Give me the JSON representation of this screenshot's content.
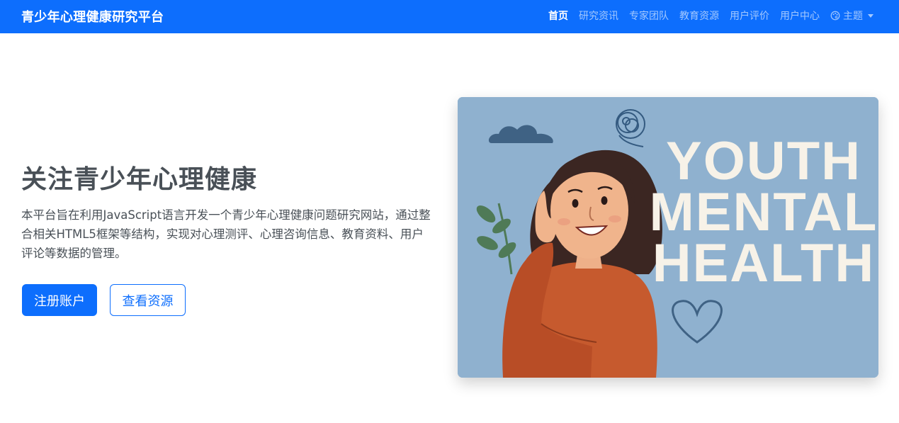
{
  "nav": {
    "brand": "青少年心理健康研究平台",
    "links": [
      {
        "label": "首页",
        "active": true
      },
      {
        "label": "研究资讯"
      },
      {
        "label": "专家团队"
      },
      {
        "label": "教育资源"
      },
      {
        "label": "用户评价"
      },
      {
        "label": "用户中心"
      }
    ],
    "theme_label": "主题"
  },
  "hero": {
    "title": "关注青少年心理健康",
    "description": "本平台旨在利用JavaScript语言开发一个青少年心理健康问题研究网站，通过整合相关HTML5框架等结构，实现对心理测评、心理咨询信息、教育资料、用户评论等数据的管理。",
    "primary_button": "注册账户",
    "secondary_button": "查看资源",
    "image": {
      "text_lines": [
        "YOUTH",
        "MENTAL",
        "HEALTH"
      ],
      "background_color": "#8fb1cf"
    }
  },
  "colors": {
    "primary": "#0d6efd",
    "text": "#495057"
  }
}
